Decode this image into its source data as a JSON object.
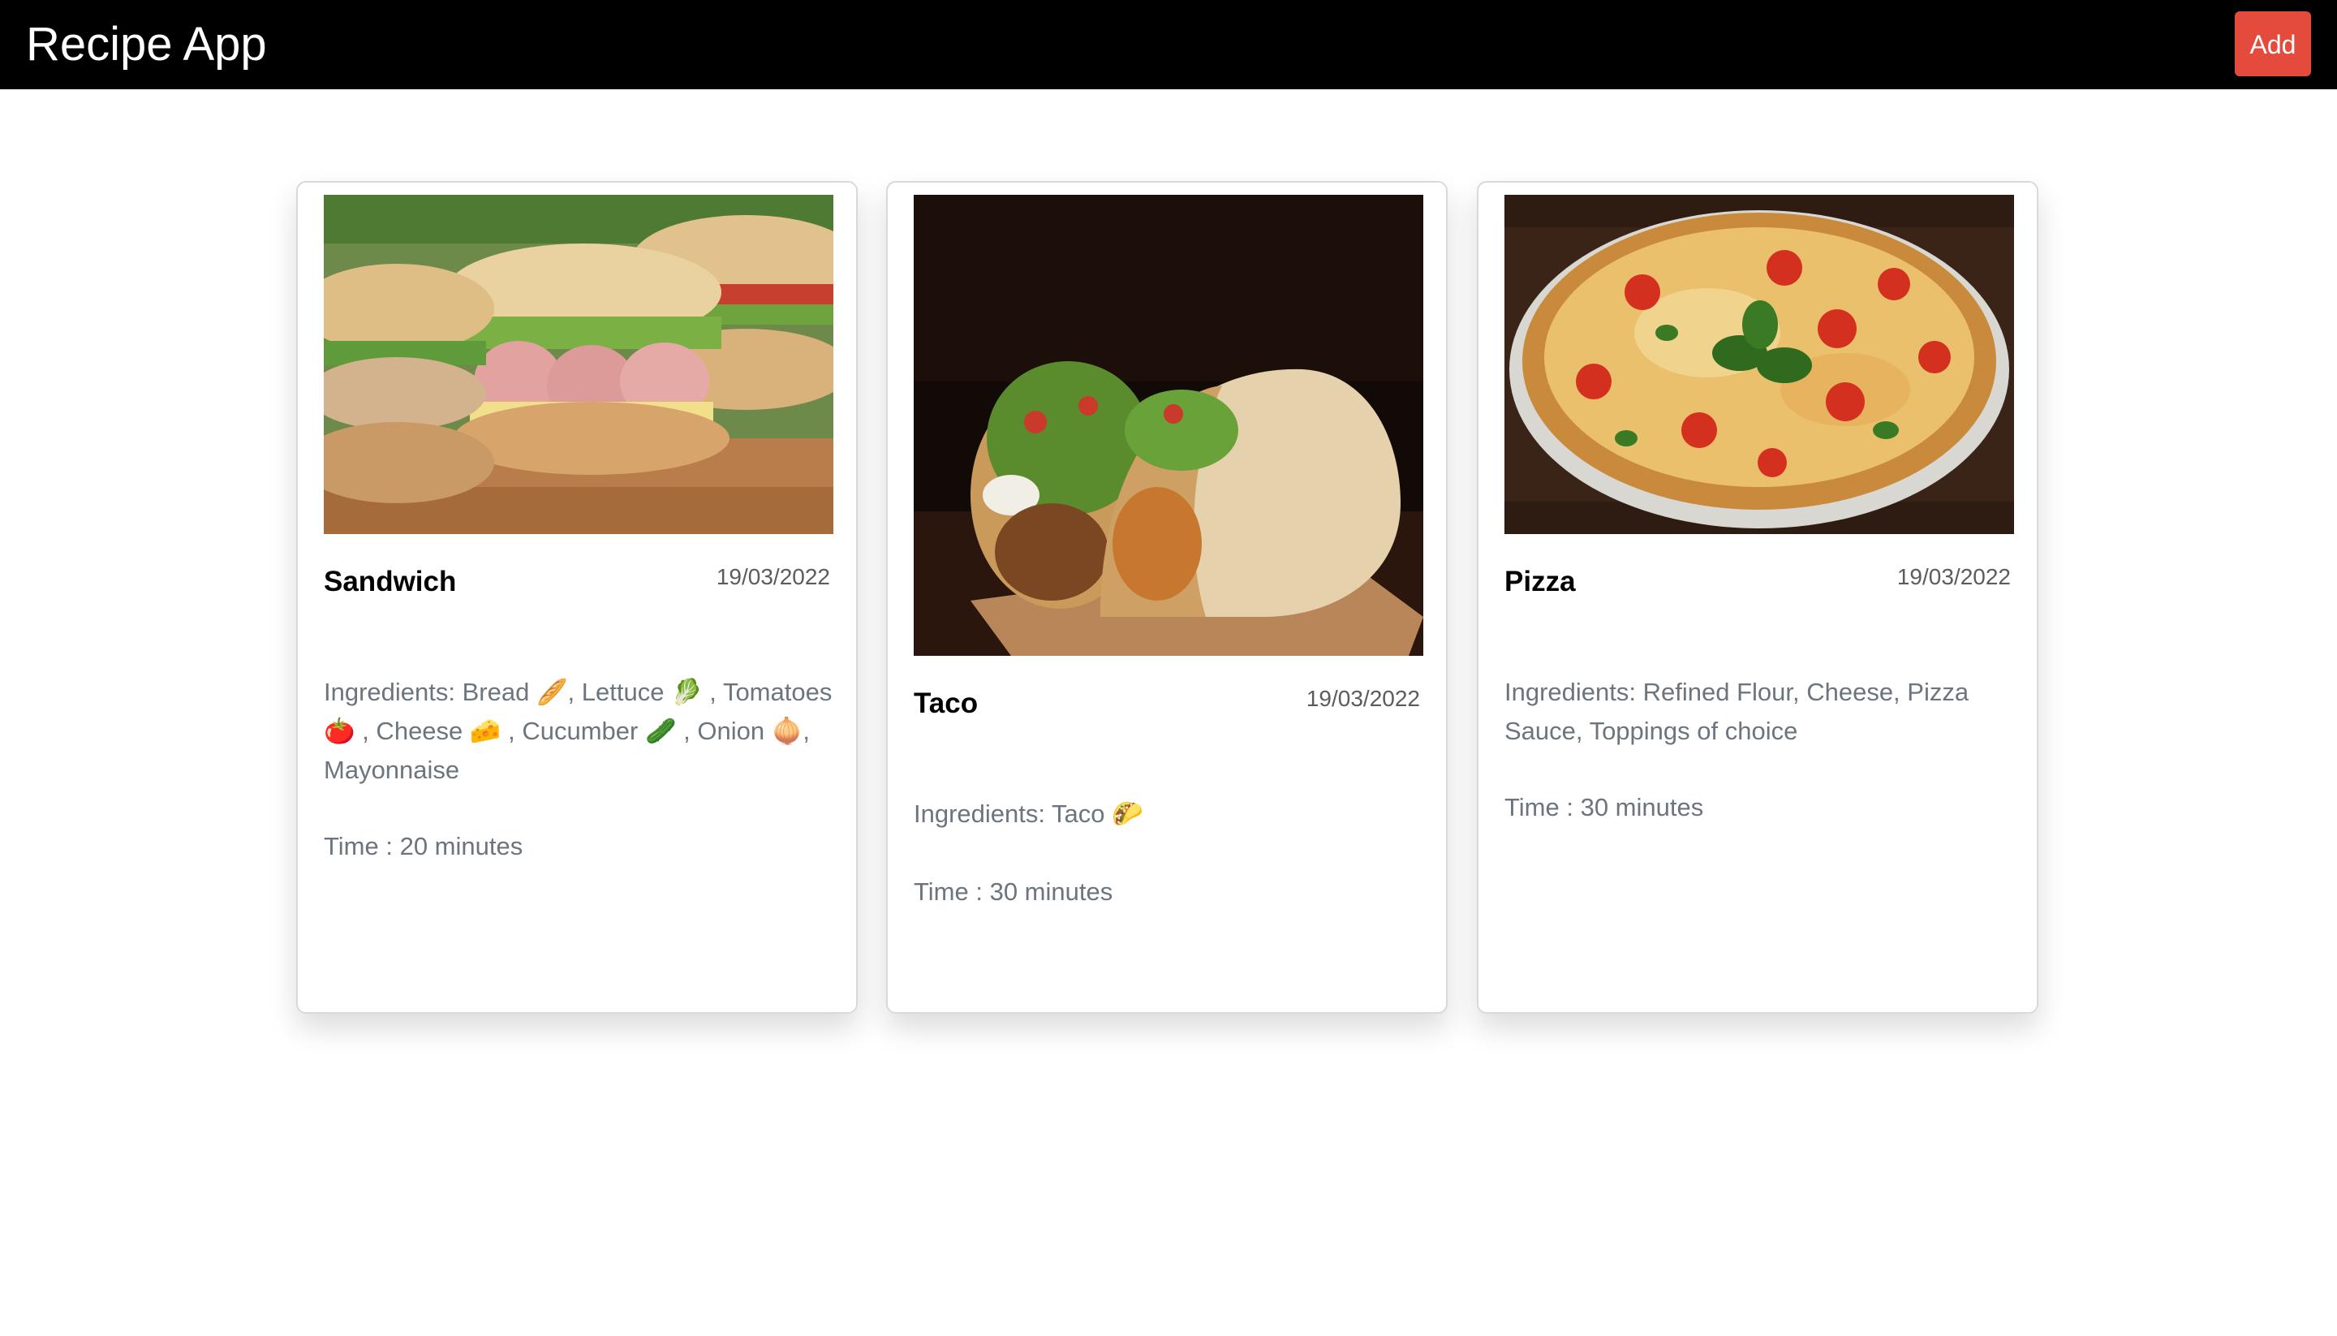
{
  "app": {
    "title": "Recipe App",
    "add_label": "Add",
    "accent_color": "#e54b3c",
    "topbar_color": "#000000"
  },
  "recipes": [
    {
      "title": "Sandwich",
      "date": "19/03/2022",
      "ingredients": "Ingredients: Bread 🥖, Lettuce 🥬 , Tomatoes 🍅 , Cheese 🧀 , Cucumber 🥒 , Onion 🧅, Mayonnaise",
      "time": "Time : 20 minutes",
      "image_subject": "sandwich"
    },
    {
      "title": "Taco",
      "date": "19/03/2022",
      "ingredients": "Ingredients: Taco 🌮",
      "time": "Time : 30 minutes",
      "image_subject": "taco"
    },
    {
      "title": "Pizza",
      "date": "19/03/2022",
      "ingredients": "Ingredients: Refined Flour, Cheese, Pizza Sauce, Toppings of choice",
      "time": "Time : 30 minutes",
      "image_subject": "pizza"
    }
  ]
}
